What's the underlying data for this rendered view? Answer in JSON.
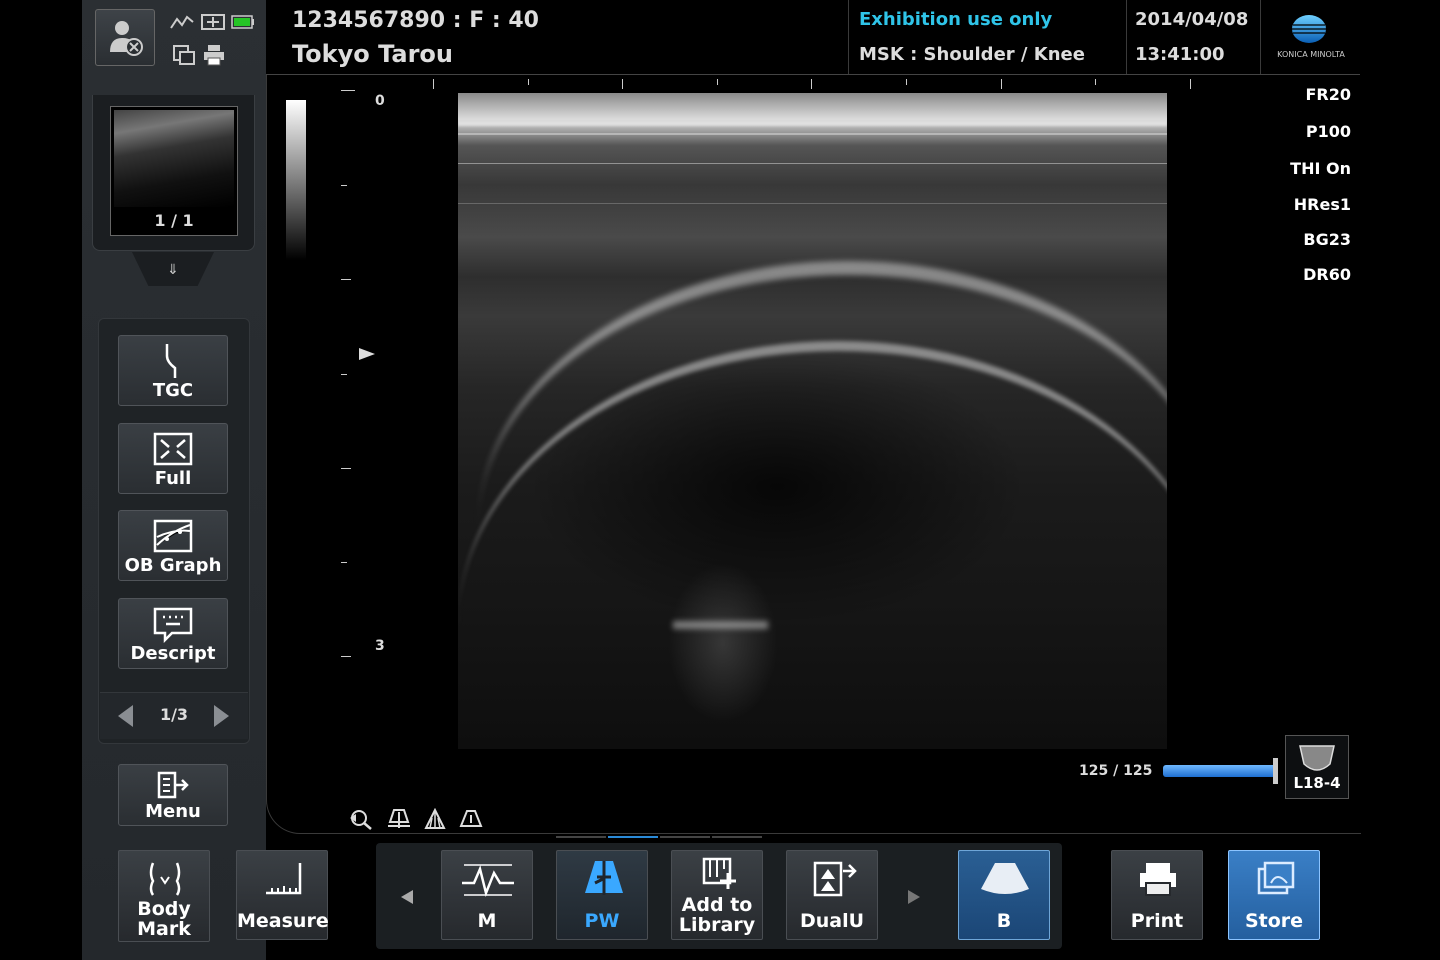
{
  "header": {
    "patient_id": "1234567890 : F : 40",
    "patient_name": "Tokyo Tarou",
    "notice": "Exhibition use only",
    "preset": "MSK : Shoulder / Knee",
    "date": "2014/04/08",
    "time": "13:41:00",
    "brand": "KONICA MINOLTA"
  },
  "thumbnail": {
    "count": "1 / 1"
  },
  "sidebar": {
    "tgc": "TGC",
    "full": "Full",
    "ob_graph": "OB Graph",
    "descript": "Descript",
    "page": "1/3",
    "menu": "Menu"
  },
  "depth": {
    "top": "0",
    "bottom": "3"
  },
  "params": [
    "FR20",
    "P100",
    "THI On",
    "HRes1",
    "BG23",
    "DR60"
  ],
  "gain": {
    "text": "125 / 125",
    "value": 125,
    "max": 125
  },
  "probe": "L18-4",
  "bottom": {
    "body_mark_1": "Body",
    "body_mark_2": "Mark",
    "measure": "Measure",
    "m": "M",
    "pw": "PW",
    "add_library_1": "Add to",
    "add_library_2": "Library",
    "dualu": "DualU",
    "b": "B",
    "print": "Print",
    "store": "Store"
  },
  "colors": {
    "notice": "#2fc4e8",
    "pw": "#3aa8ff",
    "accent": "#1f5fa8"
  }
}
